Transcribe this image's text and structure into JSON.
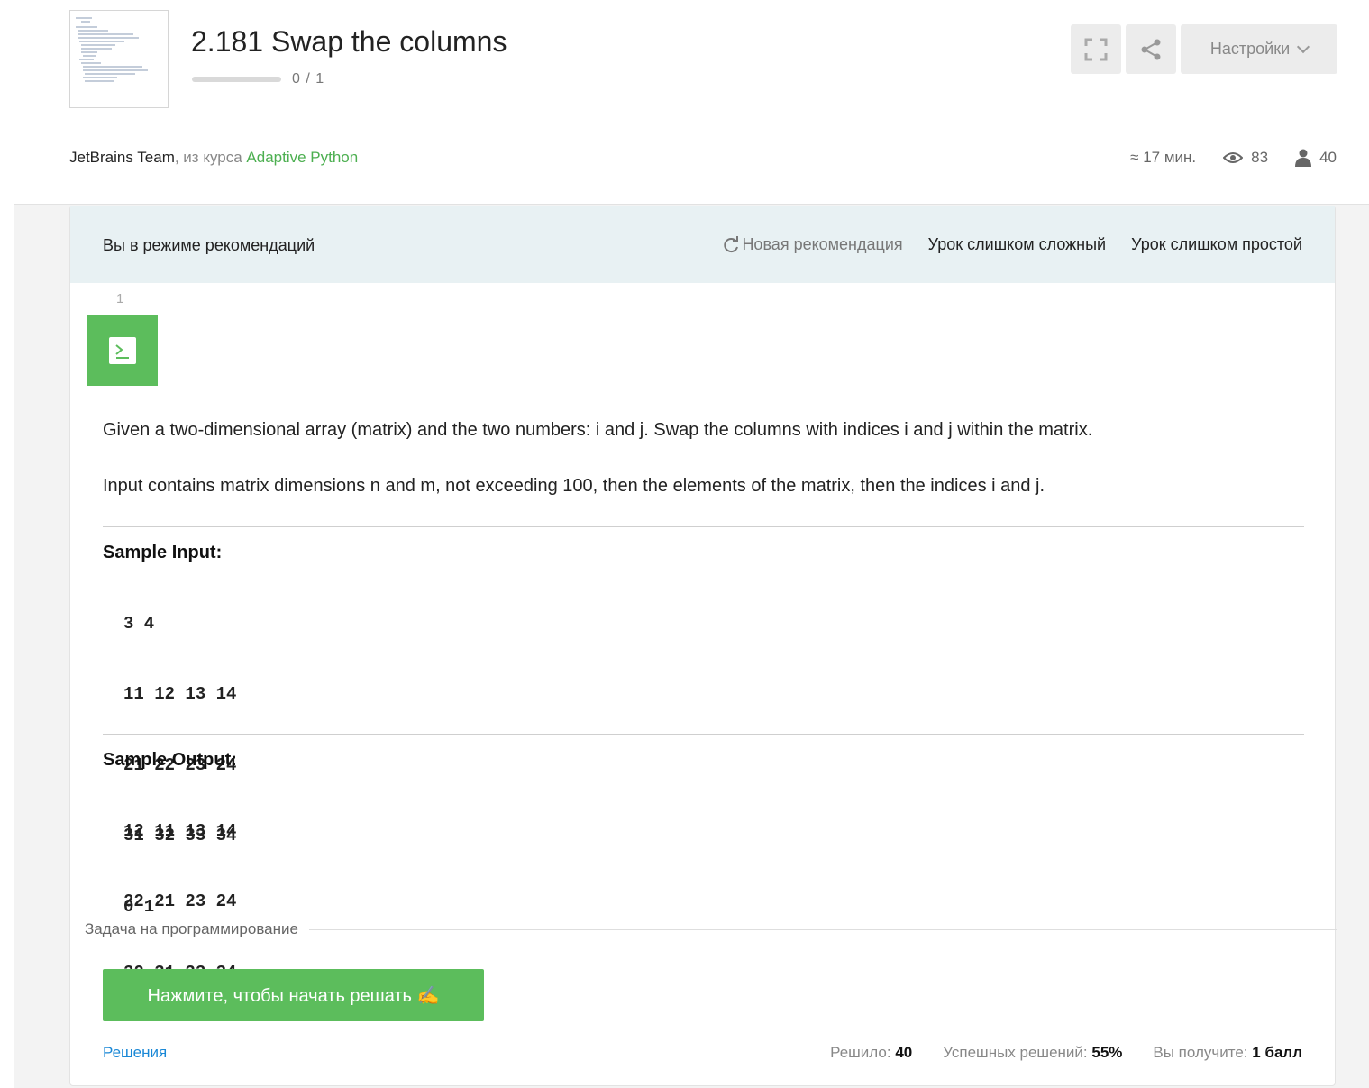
{
  "lesson": {
    "title": "2.181 Swap the columns",
    "progress_text": "0 / 1",
    "progress_fraction": 0
  },
  "toolbar": {
    "settings_label": "Настройки"
  },
  "meta": {
    "author": "JetBrains Team",
    "from_course": ", из курса",
    "course_name": "Adaptive Python",
    "time": "≈ 17 мин.",
    "views": "83",
    "learners": "40"
  },
  "recommendation": {
    "mode_text": "Вы в режиме рекомендаций",
    "new_rec": "Новая рекомендация",
    "too_hard": "Урок слишком сложный",
    "too_easy": "Урок слишком простой"
  },
  "step": {
    "number": "1",
    "para1": "Given a two-dimensional array (matrix) and the two numbers: i and j. Swap the columns with indices i and j within the matrix.",
    "para2": "Input contains matrix dimensions n and m, not exceeding 100, then the elements of the matrix, then the indices i and j.",
    "sample_input_label": "Sample Input:",
    "sample_input": [
      "3 4",
      "11 12 13 14",
      "21 22 23 24",
      "31 32 33 34",
      "0 1"
    ],
    "sample_output_label": "Sample Output:",
    "sample_output": [
      "12 11 13 14",
      "22 21 23 24",
      "32 31 33 34"
    ]
  },
  "task": {
    "label": "Задача на программирование",
    "start_button": "Нажмите, чтобы начать решать ✍",
    "solutions_link": "Решения",
    "solved_label": "Решило:",
    "solved_value": "40",
    "success_label": "Успешных решений:",
    "success_value": "55%",
    "reward_label": "Вы получите:",
    "reward_value": "1 балл"
  },
  "colors": {
    "accent_green": "#5cbd5c",
    "link_blue": "#1a88d6",
    "rec_bar_bg": "#e8f1f3"
  }
}
